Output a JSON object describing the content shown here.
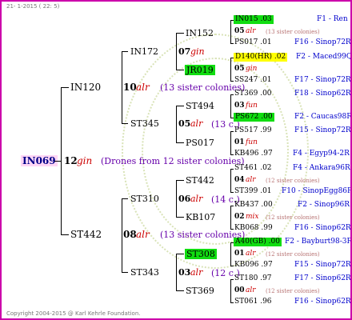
{
  "header": {
    "date": "21- 1-2015 ( 22: 5)"
  },
  "footer": {
    "copyright": "Copyright 2004-2015 @ Karl Kehrle Foundation."
  },
  "root": {
    "name": "IN069",
    "year": "12",
    "type": "gin",
    "note": "(Drones from 12 sister colonies)"
  },
  "sire": {
    "name": "IN120",
    "year": "10",
    "type": "alr",
    "note": "(13 sister colonies)"
  },
  "dam": {
    "name": "ST442",
    "year": "08",
    "type": "alr",
    "note": "(13 sister colonies)"
  },
  "gen3": {
    "a": {
      "name": "IN172",
      "year": "07",
      "type": "gin"
    },
    "b": {
      "name": "ST345",
      "year": "05",
      "type": "alr",
      "note": "(13 c.)"
    },
    "c": {
      "name": "ST310",
      "year": "06",
      "type": "alr",
      "note": "(14 c.)"
    },
    "d": {
      "name": "ST343",
      "year": "03",
      "type": "alr",
      "note": "(12 c.)"
    }
  },
  "gen4": {
    "a1": {
      "name": "IN152"
    },
    "a2": {
      "name": "JR019"
    },
    "b1": {
      "name": "ST494"
    },
    "b2": {
      "name": "PS017"
    },
    "c1": {
      "name": "ST442"
    },
    "c2": {
      "name": "KB107"
    },
    "d1": {
      "name": "ST308"
    },
    "d2": {
      "name": "ST369"
    }
  },
  "gen5": [
    {
      "top": "IN015 .03",
      "origin": "F1 - Ren",
      "mid_year": "05",
      "mid_type": "alr",
      "mid_note": "(13 sister colonies)",
      "bottom": "PS017 .01",
      "bottom_origin": "F16 - Sinop72R"
    },
    {
      "top": "D140(HR) .02",
      "origin": "F2 - Maced99Q",
      "mid_year": "05",
      "mid_type": "gin",
      "mid_note": "",
      "bottom": "SS247 .01",
      "bottom_origin": "F17 - Sinop72R"
    },
    {
      "top": "ST369 .00",
      "origin": "F18 - Sinop62R",
      "mid_year": "03",
      "mid_type": "fun",
      "mid_note": "",
      "bottom": "PS672 .00",
      "bottom_origin": "F2 - Caucas98R"
    },
    {
      "top": "PS517 .99",
      "origin": "F15 - Sinop72R",
      "mid_year": "01",
      "mid_type": "fun",
      "mid_note": "",
      "bottom": "KB496 .97",
      "bottom_origin": "F4 - Egyp94-2R"
    },
    {
      "top": "ST461 .02",
      "origin": "F4 - Ankara96R",
      "mid_year": "04",
      "mid_type": "alr",
      "mid_note": "(12 sister colonies)",
      "bottom": "ST399 .01",
      "bottom_origin": "F10 - SinopEgg86R"
    },
    {
      "top": "KB437 .00",
      "origin": "F2 - Sinop96R",
      "mid_year": "02",
      "mid_type": "mix",
      "mid_note": "(12 sister colonies)",
      "bottom": "KB068 .99",
      "bottom_origin": "F16 - Sinop62R"
    },
    {
      "top": "A40(GB) .00",
      "origin": "F2 - Bayburt98-3R",
      "mid_year": "01",
      "mid_type": "alr",
      "mid_note": "(12 sister colonies)",
      "bottom": "KB096 .97",
      "bottom_origin": "F15 - Sinop72R"
    },
    {
      "top": "ST180 .97",
      "origin": "F17 - Sinop62R",
      "mid_year": "00",
      "mid_type": "alr",
      "mid_note": "(12 sister colonies)",
      "bottom": "ST061 .96",
      "bottom_origin": "F16 - Sinop62R"
    }
  ],
  "colors": {
    "border": "#cc00aa",
    "highlight_green": "#11dd11",
    "highlight_yellow": "#ffff00",
    "root_bg": "#ffd6f5",
    "origin_text": "#0000cc",
    "type_text": "#cc0000"
  }
}
